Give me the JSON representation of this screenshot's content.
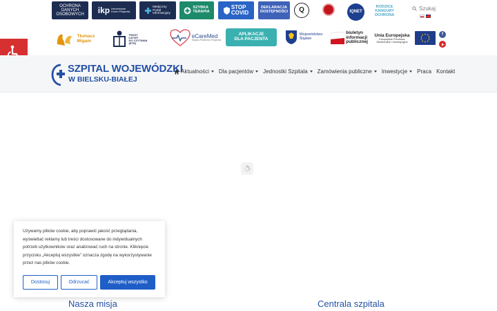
{
  "top_logos": {
    "odo_lines": [
      "OCHRONA",
      "DANYCH",
      "OSOBOWYCH"
    ],
    "ikp_big": "ikp",
    "ikp_small": [
      "Internetowe",
      "Konto Pacjenta"
    ],
    "medyczny": [
      "Medyczny",
      "Portal",
      "Informacyjny"
    ],
    "szybka": [
      "SZYBKA",
      "TERAPIA"
    ],
    "stop": [
      "STOP",
      "COVID"
    ],
    "deklaracja": [
      "DEKLARACJA",
      "DOSTĘPNOŚCI"
    ],
    "q_mark": "Q",
    "iqnet": "IQNET",
    "rodzice": [
      "RODZICE",
      "KANGURY",
      "OCHRONA"
    ]
  },
  "search": {
    "label": "Szukaj"
  },
  "second_row": {
    "tlumacz": [
      "Tłumacz",
      "Migam"
    ],
    "tekst_latwy": [
      "TEKST",
      "ŁATWY",
      "DO CZYTANIA",
      "(ETR)"
    ],
    "ecaremed": "eCareMed",
    "ecaremed_sub": "Śląska Platforma Pacjenta",
    "aplikacje": [
      "APLIKACJE",
      "DLA PACJENTA"
    ],
    "wojewodztwo": [
      "Województwo",
      "Śląskie"
    ],
    "bip": [
      "biuletyn",
      "informacji",
      "publicznej"
    ],
    "ue_title": "Unia Europejska",
    "ue_sub": [
      "Europejskie Fundusze",
      "Strukturalne i Inwestycyjne"
    ]
  },
  "brand": {
    "line1": "SZPITAL WOJEWÓDZKI",
    "line2": "W BIELSKU-BIAŁEJ"
  },
  "nav": {
    "items": [
      {
        "label": "Aktualności"
      },
      {
        "label": "Dla pacjentów"
      },
      {
        "label": "Jednostki Szpitala"
      },
      {
        "label": "Zamówienia publiczne"
      },
      {
        "label": "Inwestycje"
      },
      {
        "label": "Praca"
      },
      {
        "label": "Kontakt"
      }
    ]
  },
  "cookie": {
    "text": "Używamy plików cookie, aby poprawić jakość przeglądania, wyświetlać reklamy lub treści dostosowane do indywidualnych potrzeb użytkowników oraz analizować ruch na stronie. Kliknięcie przycisku „Akceptuj wszystkie” oznacza zgodę na wykorzystywanie przez nas plików cookie.",
    "btn_customize": "Dostosuj",
    "btn_reject": "Odrzucać",
    "btn_accept": "Akceptuj wszystko"
  },
  "sections": {
    "mission": "Nasza misja",
    "central": "Centrala szpitala"
  },
  "colors": {
    "accent": "#2350a5",
    "button": "#1f5ec7",
    "a11y": "#d63031"
  }
}
